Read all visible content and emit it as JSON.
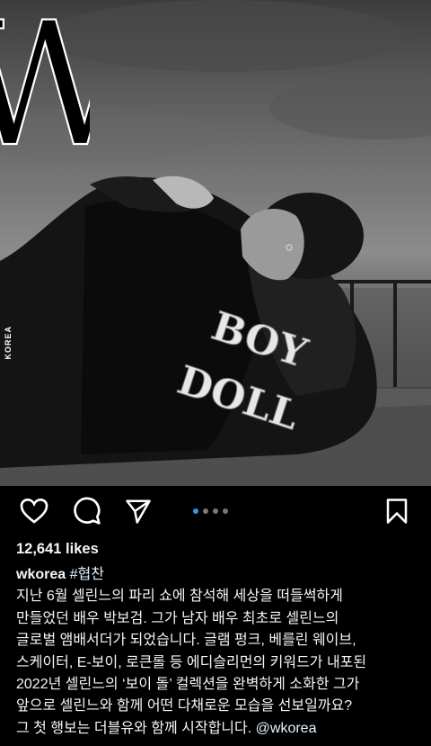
{
  "post": {
    "brand_mark": "W",
    "brand_vertical": "KOREA",
    "jacket_text_line1": "BOY",
    "jacket_text_line2": "DOLL",
    "likes": "12,641 likes",
    "username": "wkorea",
    "hashtag": "#협찬",
    "caption_lines": [
      "지난 6월 셀린느의 파리 쇼에 참석해 세상을 떠들썩하게",
      "만들었던 배우 박보검. 그가 남자 배우 최초로 셀린느의",
      "글로벌 앰배서더가 되었습니다. 글램 펑크, 베를린 웨이브,",
      "스케이터, E-보이, 로큰롤 등 에디슬리먼의 키워드가 내포된",
      "2022년 셀린느의 ‘보이 돌’ 컬렉션을 완벽하게 소화한 그가",
      "앞으로 셀린느와 함께 어떤 다채로운 모습을 선보일까요?",
      "그 첫 행보는 더블유와 함께 시작합니다."
    ],
    "mention": "@wkorea"
  },
  "carousel": {
    "count": 4,
    "active_index": 0
  },
  "icons": {
    "like": "heart-icon",
    "comment": "comment-icon",
    "share": "send-icon",
    "save": "bookmark-icon"
  },
  "colors": {
    "background": "#000000",
    "text": "#f5f5f5",
    "active_dot": "#3897f0"
  }
}
